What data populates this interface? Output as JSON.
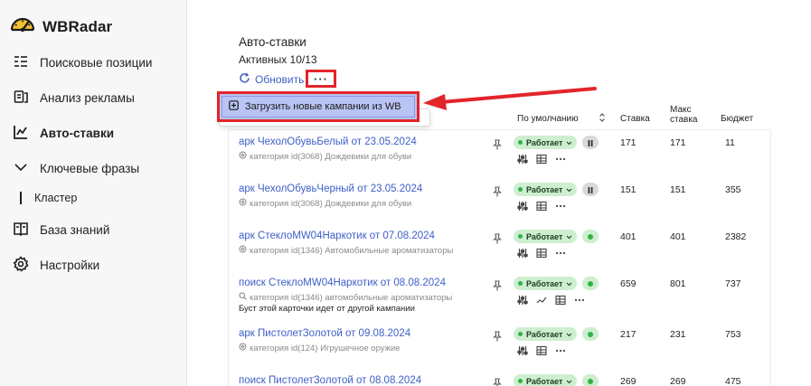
{
  "app": {
    "name": "WBRadar",
    "logo_icon": "speedometer-icon"
  },
  "sidebar": {
    "items": [
      {
        "label": "Поисковые позиции",
        "icon": "list-ordered-icon"
      },
      {
        "label": "Анализ рекламы",
        "icon": "ad-analytics-icon"
      },
      {
        "label": "Авто-ставки",
        "icon": "chart-axis-icon",
        "active": true
      },
      {
        "label": "Ключевые фразы",
        "icon": "chevron-down-icon"
      },
      {
        "label": "Кластер",
        "icon": "sub-item-bar"
      },
      {
        "label": "База знаний",
        "icon": "book-icon"
      },
      {
        "label": "Настройки",
        "icon": "gear-icon"
      }
    ]
  },
  "header": {
    "title": "Авто-ставки",
    "active": "Активных 10/13",
    "refresh_label": "Обновить",
    "more_label": "···"
  },
  "menu": {
    "item_label": "Загрузить новые кампании из WB"
  },
  "table": {
    "sort_value": "По умолчанию",
    "columns": {
      "bid": "Ставка",
      "max_bid_line1": "Макс",
      "max_bid_line2": "ставка",
      "budget": "Бюджет"
    },
    "rows": [
      {
        "name": "арк ЧехолОбувьБелый от 23.05.2024",
        "category": "категория id(3068) Дождевики для обуви",
        "cat_icon": "category-icon",
        "note": "",
        "status": "Работает",
        "toggle": "pause",
        "bid": "171",
        "max_bid": "171",
        "budget": "11",
        "actions": [
          "sliders-icon",
          "table-icon",
          "more-icon"
        ]
      },
      {
        "name": "арк ЧехолОбувьЧерный от 23.05.2024",
        "category": "категория id(3068) Дождевики для обуви",
        "cat_icon": "category-icon",
        "note": "",
        "status": "Работает",
        "toggle": "pause",
        "bid": "151",
        "max_bid": "151",
        "budget": "355",
        "actions": [
          "sliders-icon",
          "table-icon",
          "more-icon"
        ]
      },
      {
        "name": "арк СтеклоMW04Наркотик от 07.08.2024",
        "category": "категория id(1346) Автомобильные ароматизаторы",
        "cat_icon": "category-icon",
        "note": "",
        "status": "Работает",
        "toggle": "play",
        "bid": "401",
        "max_bid": "401",
        "budget": "2382",
        "actions": [
          "sliders-icon",
          "table-icon",
          "more-icon"
        ]
      },
      {
        "name": "поиск СтеклоMW04Наркотик от 08.08.2024",
        "category": "категория id(1346) автомобильные ароматизаторы",
        "cat_icon": "search-icon",
        "note": "Буст этой карточки идет от другой кампании",
        "status": "Работает",
        "toggle": "play",
        "bid": "659",
        "max_bid": "801",
        "budget": "737",
        "actions": [
          "sliders-icon",
          "line-chart-icon",
          "table-icon",
          "more-icon"
        ]
      },
      {
        "name": "арк ПистолетЗолотой от 09.08.2024",
        "category": "категория id(124) Игрушечное оружие",
        "cat_icon": "category-icon",
        "note": "",
        "status": "Работает",
        "toggle": "play",
        "bid": "217",
        "max_bid": "231",
        "budget": "753",
        "actions": [
          "sliders-icon",
          "table-icon",
          "more-icon"
        ]
      },
      {
        "name": "поиск ПистолетЗолотой от 08.08.2024",
        "category": "",
        "cat_icon": "",
        "note": "",
        "status": "Работает",
        "toggle": "play",
        "bid": "269",
        "max_bid": "269",
        "budget": "475",
        "actions": []
      }
    ]
  },
  "colors": {
    "accent": "#3e5fc7",
    "highlight": "#e3242b",
    "status_bg": "#cdeecf",
    "status_dot": "#2fb24a",
    "menu_bg": "#b9c4f4"
  }
}
